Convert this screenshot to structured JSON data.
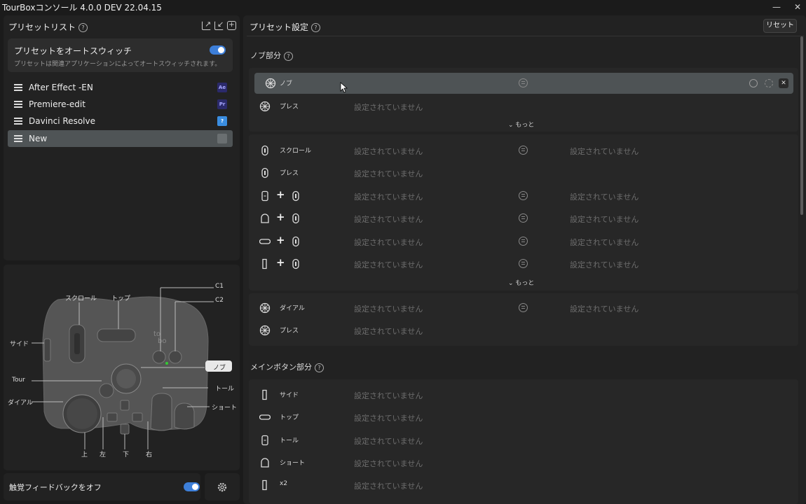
{
  "window": {
    "title": "TourBoxコンソール 4.0.0 DEV 22.04.15",
    "min": "—",
    "close": "✕"
  },
  "left": {
    "title": "プリセットリスト",
    "help": "?",
    "auto_switch": {
      "title": "プリセットをオートスウィッチ",
      "desc": "プリセットは関連アプリケーションによってオートスウィッチされます。"
    },
    "presets": [
      {
        "name": "After Effect -EN",
        "badge": "Ae",
        "color": "#2b2a6b",
        "fg": "#a7a7ff"
      },
      {
        "name": "Premiere-edit",
        "badge": "Pr",
        "color": "#2b2a6b",
        "fg": "#a7a7ff"
      },
      {
        "name": "Davinci Resolve",
        "badge": "?",
        "color": "#3a8de0",
        "fg": "#ffffff"
      },
      {
        "name": "New",
        "badge": "",
        "color": "#6a6f71",
        "fg": "#ffffff"
      }
    ],
    "device_labels": {
      "scroll": "スクロール",
      "top": "トップ",
      "c1": "C1",
      "c2": "C2",
      "side": "サイド",
      "knob": "ノブ",
      "tour": "Tour",
      "tall": "トール",
      "dial": "ダイアル",
      "short": "ショート",
      "up": "上",
      "left": "左",
      "down": "下",
      "right": "右"
    },
    "haptic": "触覚フィードバックをオフ"
  },
  "right": {
    "title": "プリセット設定",
    "help": "?",
    "reset": "リセット",
    "knob_section": "ノブ部分",
    "main_section": "メインボタン部分",
    "more": "もっと",
    "unset": "設定されていません",
    "knob_rows": [
      {
        "label": "ノブ"
      },
      {
        "label": "プレス"
      }
    ],
    "scroll_rows": [
      {
        "label": "スクロール"
      },
      {
        "label": "プレス"
      }
    ],
    "combo_rows": [
      {
        "label": ""
      },
      {
        "label": ""
      },
      {
        "label": ""
      },
      {
        "label": ""
      }
    ],
    "dial_rows": [
      {
        "label": "ダイアル"
      },
      {
        "label": "プレス"
      }
    ],
    "main_rows": [
      {
        "label": "サイド"
      },
      {
        "label": "トップ"
      },
      {
        "label": "トール"
      },
      {
        "label": "ショート"
      },
      {
        "label": "x2"
      }
    ]
  }
}
